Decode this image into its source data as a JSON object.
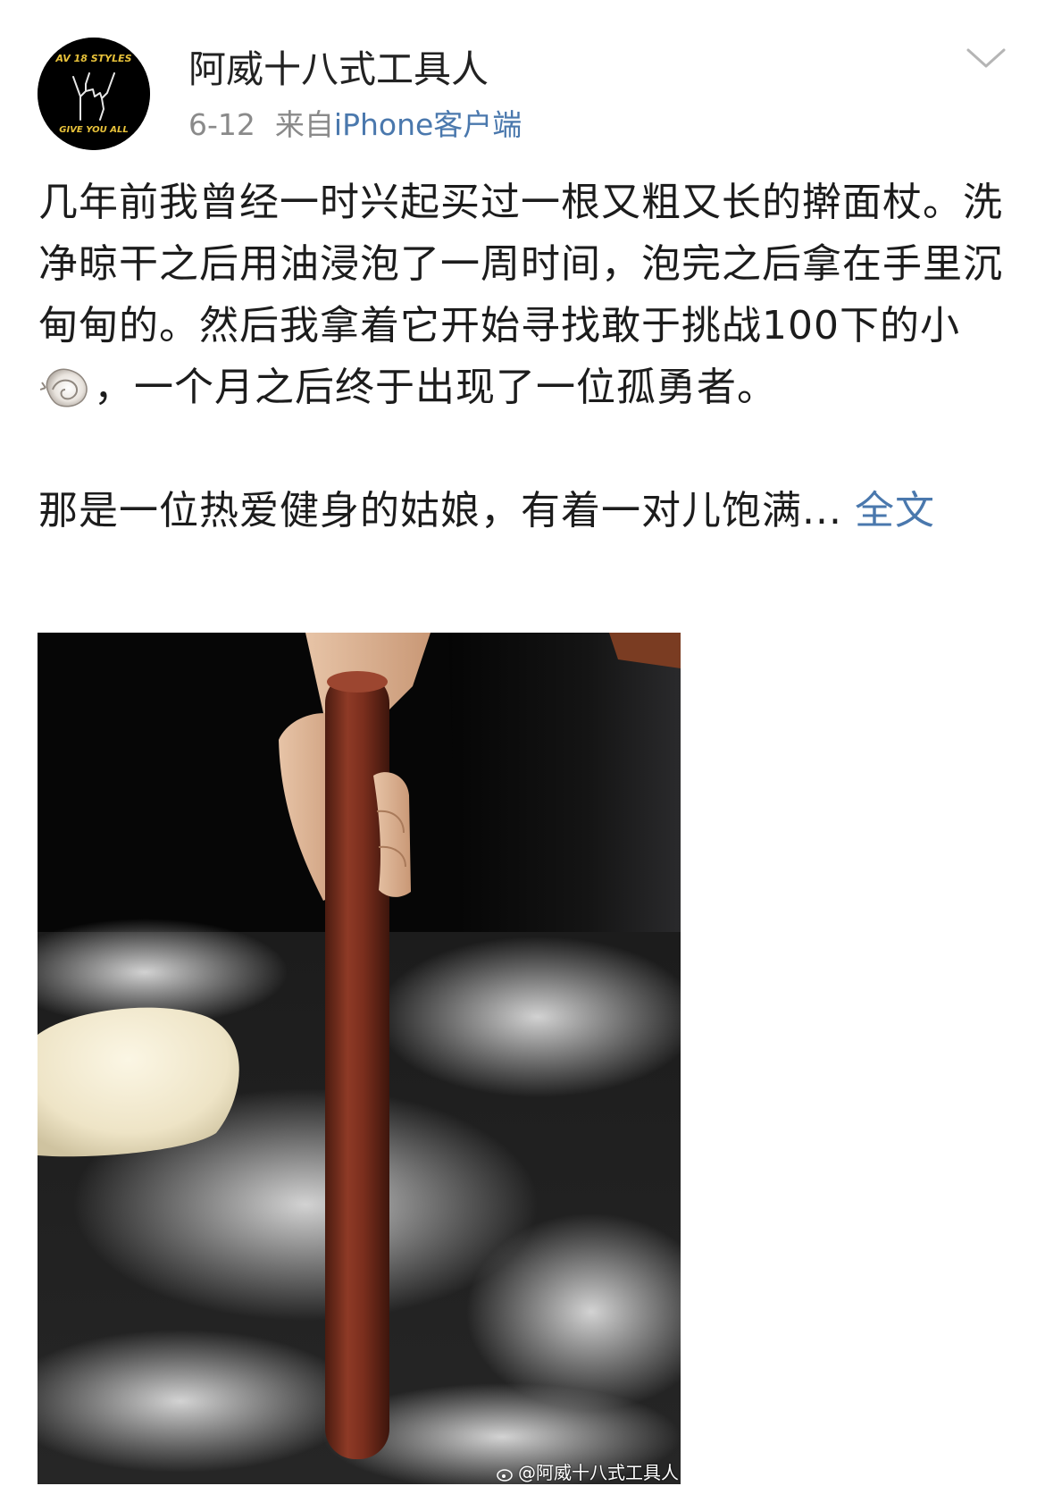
{
  "post": {
    "author": {
      "name": "阿威十八式工具人",
      "avatar_text_top": "AV 18 STYLES",
      "avatar_text_bottom": "GIVE YOU ALL"
    },
    "date": "6-12",
    "source_prefix": "来自",
    "source_client": "iPhone客户端",
    "menu_icon": "chevron-down-icon",
    "paragraph1_before_emoji": "几年前我曾经一时兴起买过一根又粗又长的擀面杖。洗净晾干之后用油浸泡了一周时间，泡完之后拿在手里沉甸甸的。然后我拿着它开始寻找敢于挑战100下的小",
    "emoji_name": "snail-emoji",
    "paragraph1_after_emoji": "，一个月之后终于出现了一位孤勇者。",
    "paragraph2": "那是一位热爱健身的姑娘，有着一对儿饱满...",
    "expand_label": "全文",
    "image": {
      "description_icon": "rolling-pin-photo",
      "watermark": "@阿威十八式工具人"
    }
  },
  "colors": {
    "link": "#4a78ad",
    "meta": "#8a8a8a",
    "text": "#1c1c1c"
  }
}
